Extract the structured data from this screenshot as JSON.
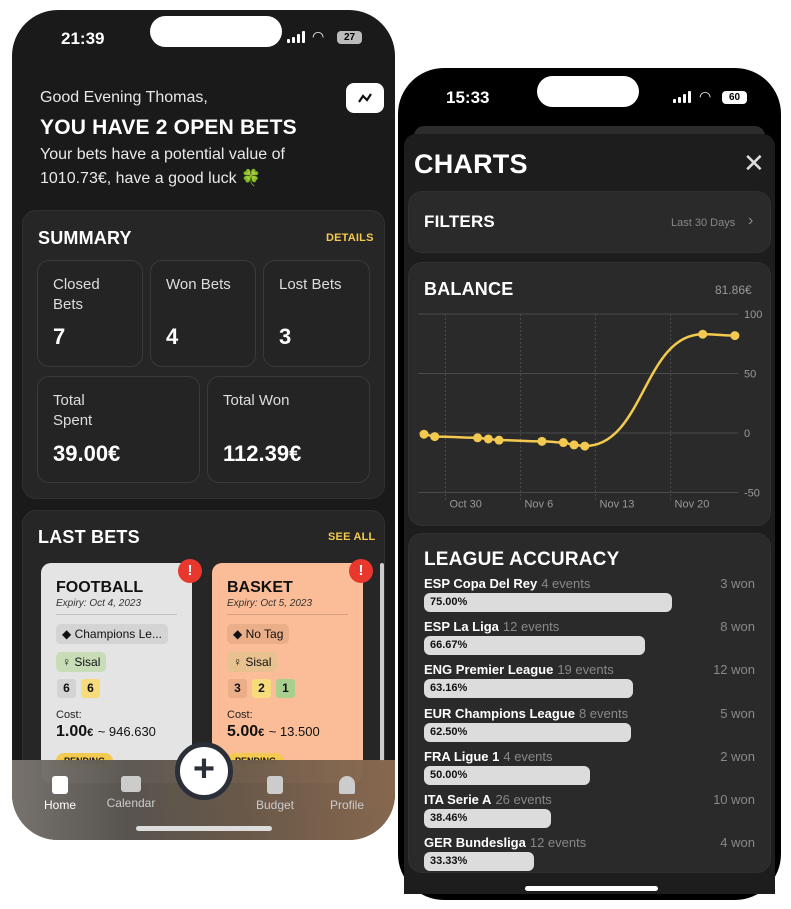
{
  "left_phone": {
    "status": {
      "time": "21:39",
      "battery": "27"
    },
    "header": {
      "greeting": "Good Evening Thomas,",
      "title": "YOU HAVE 2 OPEN BETS",
      "subtitle_line1": "Your bets have a potential value of",
      "subtitle_line2": "1010.73€, have a good luck 🍀",
      "chart_button_icon": "chart-line-icon"
    },
    "summary": {
      "title": "SUMMARY",
      "details_label": "DETAILS",
      "stats": [
        {
          "label": "Closed Bets",
          "value": "7"
        },
        {
          "label": "Won Bets",
          "value": "4"
        },
        {
          "label": "Lost Bets",
          "value": "3"
        },
        {
          "label": "Total Spent",
          "value": "39.00€"
        },
        {
          "label": "Total Won",
          "value": "112.39€"
        }
      ]
    },
    "last_bets": {
      "title": "LAST BETS",
      "see_all_label": "SEE ALL",
      "bets": [
        {
          "sport": "FOOTBALL",
          "expiry": "Expiry: Oct 4, 2023",
          "tag": "Champions Le...",
          "bookmaker": "Sisal",
          "counts": [
            "6",
            "6"
          ],
          "cost_label": "Cost:",
          "cost": "1.00",
          "currency": "€",
          "potential": "~ 946.630",
          "status": "PENDING",
          "color": "#e4e4e4"
        },
        {
          "sport": "BASKET",
          "expiry": "Expiry: Oct 5, 2023",
          "tag": "No Tag",
          "bookmaker": "Sisal",
          "counts": [
            "3",
            "2",
            "1"
          ],
          "cost_label": "Cost:",
          "cost": "5.00",
          "currency": "€",
          "potential": "~ 13.500",
          "status": "PENDING",
          "color": "#fbbd97"
        }
      ]
    },
    "tabbar": {
      "items": [
        {
          "label": "Home"
        },
        {
          "label": "Calendar"
        },
        {
          "label": "Budget"
        },
        {
          "label": "Profile"
        }
      ],
      "add_icon": "plus-icon"
    }
  },
  "right_phone": {
    "status": {
      "time": "15:33",
      "battery": "60"
    },
    "title": "CHARTS",
    "filters": {
      "title": "FILTERS",
      "value": "Last 30 Days"
    },
    "balance": {
      "title": "BALANCE",
      "value": "81.86€"
    },
    "league_accuracy": {
      "title": "LEAGUE ACCURACY",
      "rows": [
        {
          "league": "ESP Copa Del Rey",
          "events": "4 events",
          "won": "3 won",
          "pct": 75.0,
          "pct_label": "75.00%"
        },
        {
          "league": "ESP La Liga",
          "events": "12 events",
          "won": "8 won",
          "pct": 66.67,
          "pct_label": "66.67%"
        },
        {
          "league": "ENG Premier League",
          "events": "19 events",
          "won": "12 won",
          "pct": 63.16,
          "pct_label": "63.16%"
        },
        {
          "league": "EUR Champions League",
          "events": "8 events",
          "won": "5 won",
          "pct": 62.5,
          "pct_label": "62.50%"
        },
        {
          "league": "FRA Ligue 1",
          "events": "4 events",
          "won": "2 won",
          "pct": 50.0,
          "pct_label": "50.00%"
        },
        {
          "league": "ITA Serie A",
          "events": "26 events",
          "won": "10 won",
          "pct": 38.46,
          "pct_label": "38.46%"
        },
        {
          "league": "GER Bundesliga",
          "events": "12 events",
          "won": "4 won",
          "pct": 33.33,
          "pct_label": "33.33%"
        }
      ]
    }
  },
  "accent": "#f3c94f",
  "chart_data": {
    "type": "line",
    "title": "BALANCE",
    "ylim": [
      -50,
      100
    ],
    "yticks": [
      "100",
      "50",
      "0",
      "-50"
    ],
    "ytick_values": [
      100,
      50,
      0,
      -50
    ],
    "xticks": [
      "Oct 30",
      "Nov 6",
      "Nov 13",
      "Nov 20"
    ],
    "grid": true,
    "color": "#f3c94f",
    "x": [
      "Oct 28",
      "Oct 29",
      "Nov 2",
      "Nov 3",
      "Nov 4",
      "Nov 8",
      "Nov 10",
      "Nov 11",
      "Nov 12",
      "Nov 23",
      "Nov 26"
    ],
    "y": [
      -1,
      -3,
      -4,
      -5,
      -6,
      -7,
      -8,
      -10,
      -11,
      83,
      81.86
    ]
  }
}
